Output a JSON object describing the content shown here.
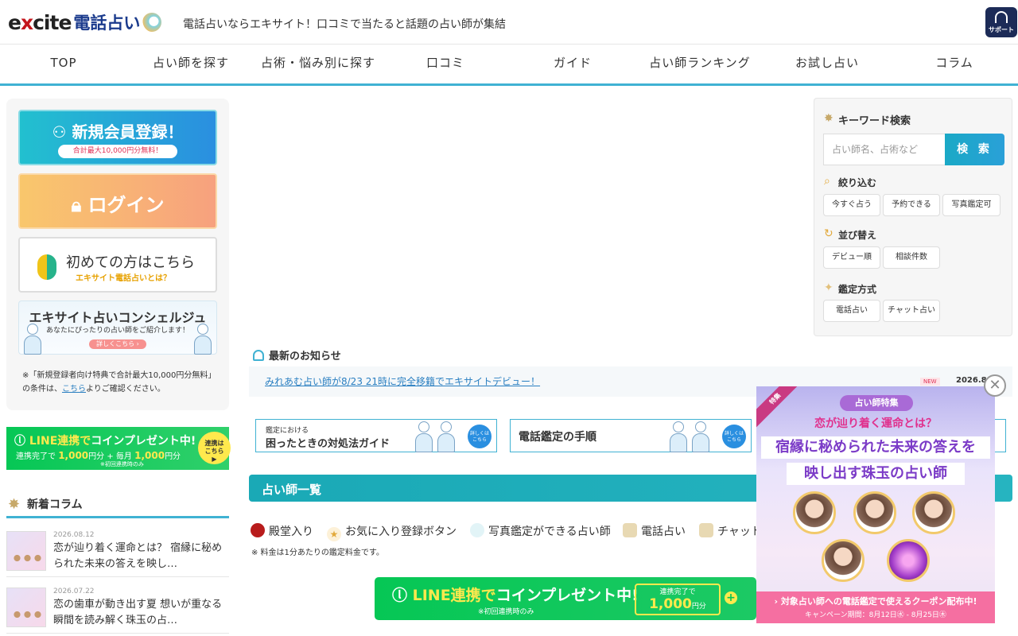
{
  "header": {
    "logo_excite_pre": "e",
    "logo_excite_x": "x",
    "logo_excite_post": "cite",
    "logo_jp": "電話占い",
    "tagline": "電話占いならエキサイト！口コミで当たると話題の占い師が集結",
    "support_label": "サポート"
  },
  "nav": [
    "TOP",
    "占い師を探す",
    "占術・悩み別に探す",
    "口コミ",
    "ガイド",
    "占い師ランキング",
    "お試し占い",
    "コラム"
  ],
  "left": {
    "register_label": "新規会員登録！",
    "register_sub": "合計最大10,000円分無料！",
    "login_label": "ログイン",
    "first_label": "初めての方はこちら",
    "first_sub": "エキサイト電話占いとは？",
    "concierge_title": "エキサイト占いコンシェルジュ",
    "concierge_sub": "あなたにぴったりの占い師をご紹介します！",
    "concierge_btn": "詳しくこちら ›",
    "note_1": "※「新規登録者向け特典で合計最大10,000円分無料」",
    "note_2_pre": "の条件は、",
    "note_link": "こちら",
    "note_2_post": "よりご確認ください。"
  },
  "line_banner": {
    "title_pre": "LINE連携で",
    "title_post": "コインプレゼント中!",
    "sub_1": "連携完了で",
    "amount_1": "1,000",
    "sub_2": "円分",
    "sub_3": "毎月",
    "amount_2": "1,000",
    "sub_4": "円分",
    "small": "※初回連携時のみ",
    "circle_1": "連携は",
    "circle_2": "こちら",
    "circle_3": "▶"
  },
  "new_columns": {
    "heading": "新着コラム",
    "items": [
      {
        "date": "2026.08.12",
        "title": "恋が辿り着く運命とは？ 宿縁に秘められた未来の答えを映し…"
      },
      {
        "date": "2026.07.22",
        "title": "恋の歯車が動き出す夏 想いが重なる瞬間を読み解く珠玉の占…"
      }
    ]
  },
  "notice": {
    "heading": "最新のお知らせ",
    "link": "みれあむ占い師が8/23 21時に完全移籍でエキサイトデビュー！",
    "badge": "NEW",
    "date": "2026.8.1"
  },
  "guides": {
    "g1_small": "鑑定における",
    "g1_big": "困ったときの対処法ガイド",
    "g2_big": "電話鑑定の手順",
    "detail_1": "詳しくは",
    "detail_2": "こちら"
  },
  "list": {
    "heading": "占い師一覧",
    "legend": [
      "殿堂入り",
      "お気に入り登録ボタン",
      "写真鑑定ができる占い師",
      "電話占い",
      "チャット"
    ],
    "fee_note": "※ 料金は1分あたりの鑑定料金です。"
  },
  "line_big": {
    "title_pre": "LINE連携で",
    "title_post": "コインプレゼント中!",
    "small": "※初回連携時のみ",
    "box_top": "連携完了で",
    "box_amount": "1,000",
    "box_unit": "円分",
    "plus": "+"
  },
  "search": {
    "keyword_heading": "キーワード検索",
    "placeholder": "占い師名、占術など",
    "button": "検 索",
    "filter_heading": "絞り込む",
    "filter_chips": [
      "今すぐ占う",
      "予約できる",
      "写真鑑定可"
    ],
    "sort_heading": "並び替え",
    "sort_chips": [
      "デビュー順",
      "相談件数"
    ],
    "method_heading": "鑑定方式",
    "method_chips": [
      "電話占い",
      "チャット占い"
    ]
  },
  "popup": {
    "ribbon": "特集",
    "pill": "占い師特集",
    "headline": "恋が辿り着く運命とは？",
    "line_1": "宿縁に秘められた未来の答えを",
    "line_2": "映し出す珠玉の占い師",
    "footer_main": "› 対象占い師への電話鑑定で使えるクーポン配布中!",
    "footer_sub": "キャンペーン期間：8月12日㊌ - 8月25日㊍",
    "close": "✕"
  },
  "colors": {
    "accent": "#40b2d3",
    "teal": "#1aa9b6",
    "line": "#06c755",
    "pink": "#e0308d"
  }
}
